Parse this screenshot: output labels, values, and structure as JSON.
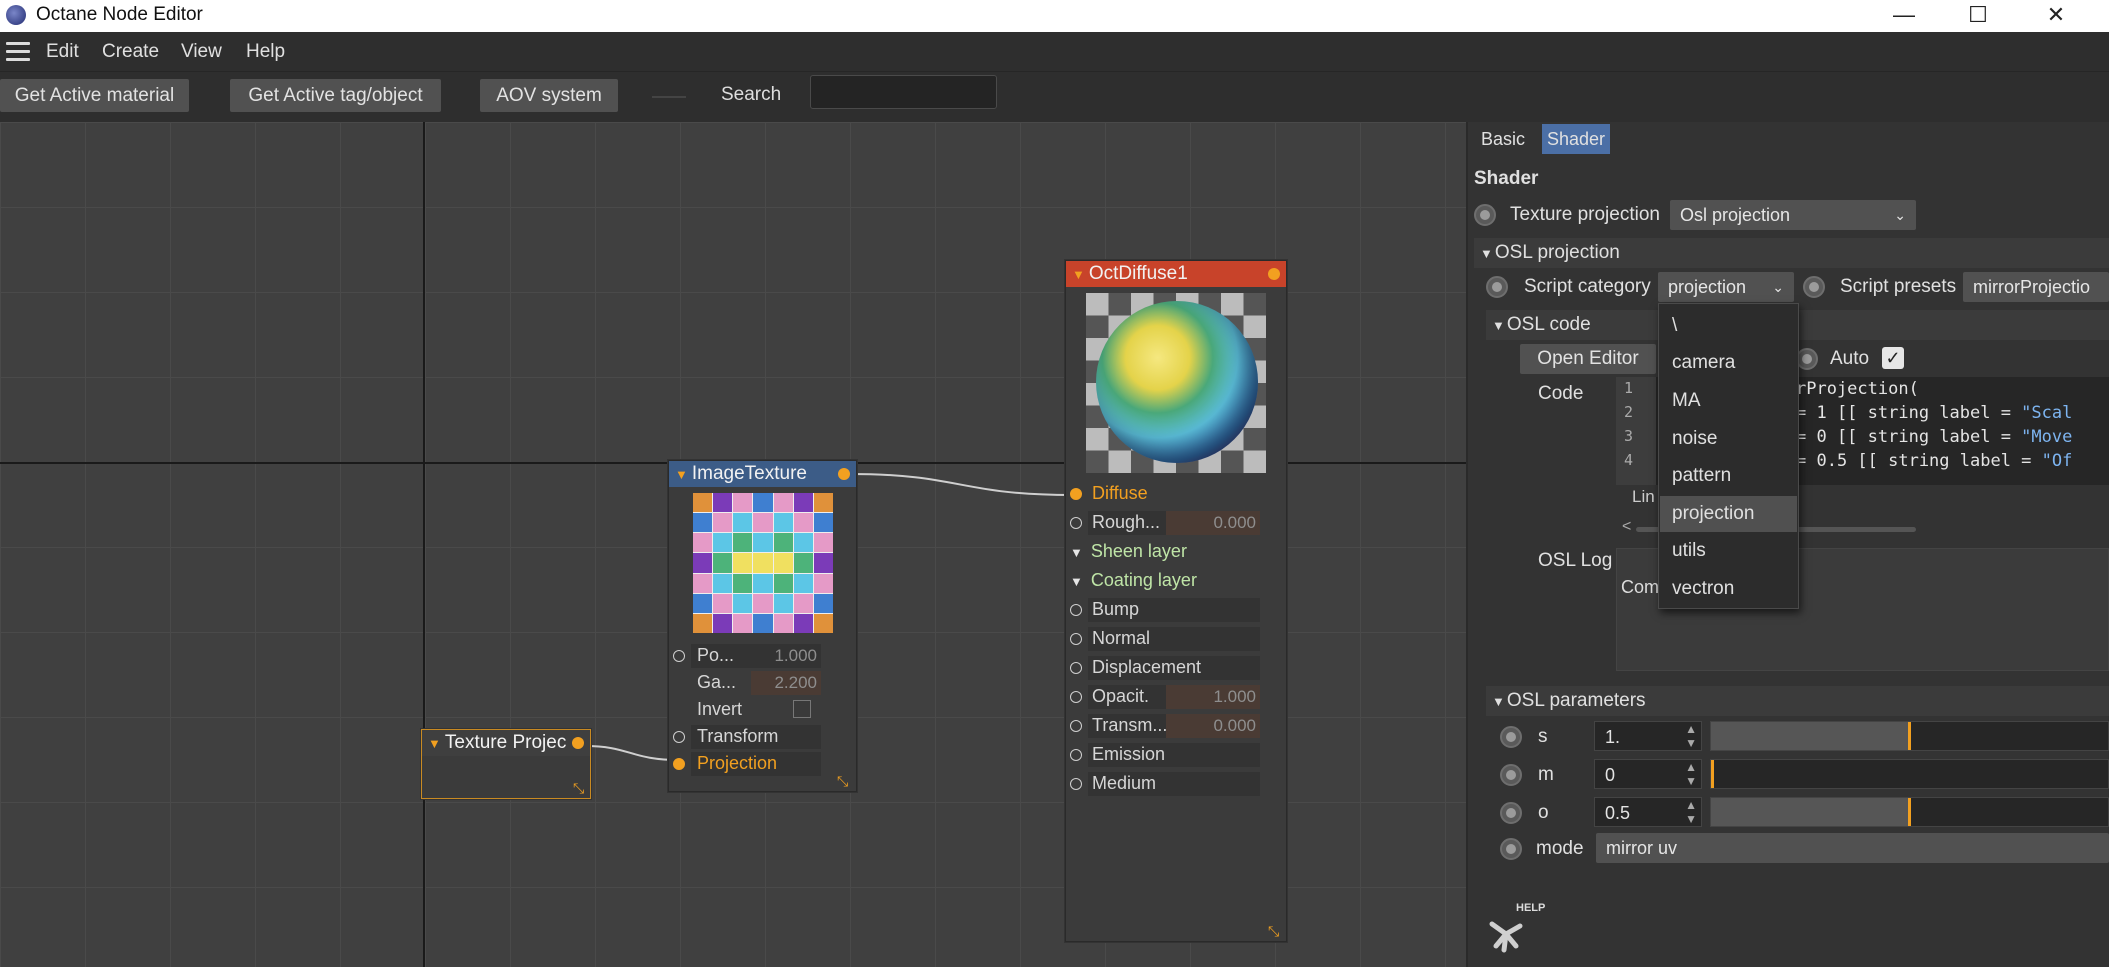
{
  "window": {
    "title": "Octane Node Editor",
    "controls": {
      "minimize": "—",
      "maximize": "☐",
      "close": "✕"
    }
  },
  "menu": {
    "items": [
      "Edit",
      "Create",
      "View",
      "Help"
    ]
  },
  "toolbar": {
    "get_active_material": "Get Active material",
    "get_active_tag": "Get Active tag/object",
    "aov_system": "AOV system",
    "search_label": "Search",
    "search_value": ""
  },
  "nodes": {
    "texture_projection": {
      "title": "Texture Projec"
    },
    "image_texture": {
      "title": "ImageTexture",
      "pins": {
        "power": {
          "label": "Po...",
          "value": "1.000"
        },
        "gamma": {
          "label": "Ga...",
          "value": "2.200"
        },
        "invert": {
          "label": "Invert"
        },
        "transform": {
          "label": "Transform"
        },
        "projection": {
          "label": "Projection"
        }
      }
    },
    "oct_diffuse": {
      "title": "OctDiffuse1",
      "pins": {
        "diffuse": "Diffuse",
        "roughness": {
          "label": "Rough...",
          "value": "0.000"
        },
        "sheen_layer": "Sheen layer",
        "coating_layer": "Coating layer",
        "bump": "Bump",
        "normal": "Normal",
        "displacement": "Displacement",
        "opacity": {
          "label": "Opacit.",
          "value": "1.000"
        },
        "transmission": {
          "label": "Transm...",
          "value": "0.000"
        },
        "emission": "Emission",
        "medium": "Medium"
      }
    }
  },
  "panel": {
    "tabs": [
      "Basic",
      "Shader"
    ],
    "heading": "Shader",
    "texture_projection": {
      "label": "Texture projection",
      "value": "Osl projection"
    },
    "osl_projection": {
      "title": "OSL projection",
      "script_category": {
        "label": "Script category",
        "value": "projection"
      },
      "script_presets": {
        "label": "Script presets",
        "value": "mirrorProjectio"
      }
    },
    "osl_code": {
      "title": "OSL code",
      "open_editor": "Open Editor",
      "auto_label": "Auto",
      "auto_checked": "✓",
      "code_label": "Code",
      "line_numbers": [
        "1",
        "2",
        "3",
        "4"
      ],
      "lines": [
        {
          "code": "rProjection(",
          "str": ""
        },
        {
          "code": "= 1 [[ string label = ",
          "str": "\"Scal"
        },
        {
          "code": "= 0 [[ string label = ",
          "str": "\"Move"
        },
        {
          "code": "= 0.5 [[ string label = ",
          "str": "\"Of"
        }
      ],
      "status_prefix": "Lin",
      "scroll_left": "<",
      "log_label": "OSL Log",
      "log_prefix": "Com"
    },
    "osl_parameters": {
      "title": "OSL parameters",
      "params": [
        {
          "name": "s",
          "value": "1.",
          "level": 0.5
        },
        {
          "name": "m",
          "value": "0",
          "level": 0.0
        },
        {
          "name": "o",
          "value": "0.5",
          "level": 0.5
        }
      ],
      "mode": {
        "label": "mode",
        "value": "mirror uv"
      }
    },
    "help": "HELP"
  },
  "category_popup": {
    "items": [
      "\\",
      "camera",
      "MA",
      "noise",
      "pattern",
      "projection",
      "utils",
      "vectron"
    ],
    "selected": "projection"
  },
  "colors": {
    "accent": "#f2a020",
    "active_tab": "#4b6fa6",
    "diffuse_header": "#c8432a",
    "texture_header": "#3c5c87"
  }
}
